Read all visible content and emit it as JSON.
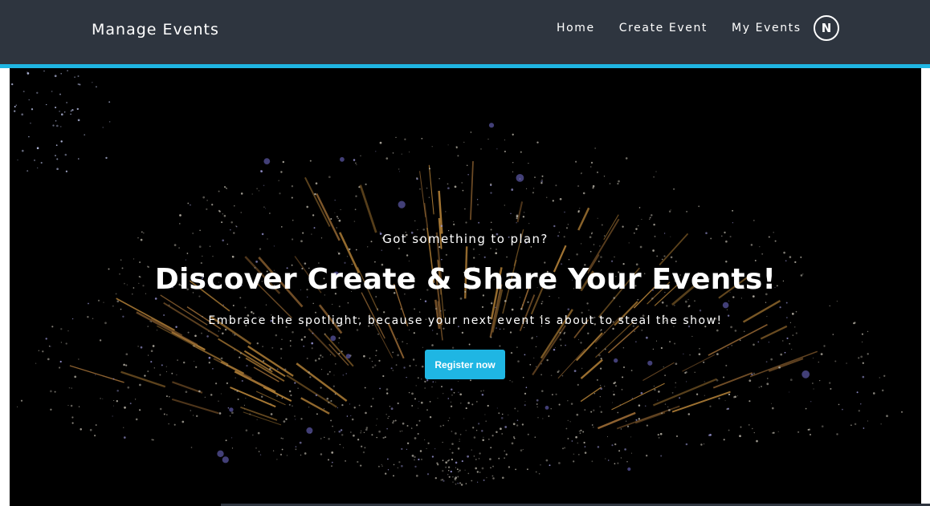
{
  "navbar": {
    "brand": "Manage Events",
    "links": [
      {
        "label": "Home"
      },
      {
        "label": "Create Event"
      },
      {
        "label": "My Events"
      }
    ],
    "avatar_initial": "N"
  },
  "hero": {
    "subtitle": "Got something to plan?",
    "title": "Discover Create & Share Your Events!",
    "tagline": "Embrace the spotlight, because your next event is about to steal the show!",
    "cta_label": "Register now",
    "background": "fireworks-image"
  },
  "colors": {
    "navbar_bg": "#2e353f",
    "accent": "#1fb6e3",
    "hero_bg": "#000000"
  }
}
